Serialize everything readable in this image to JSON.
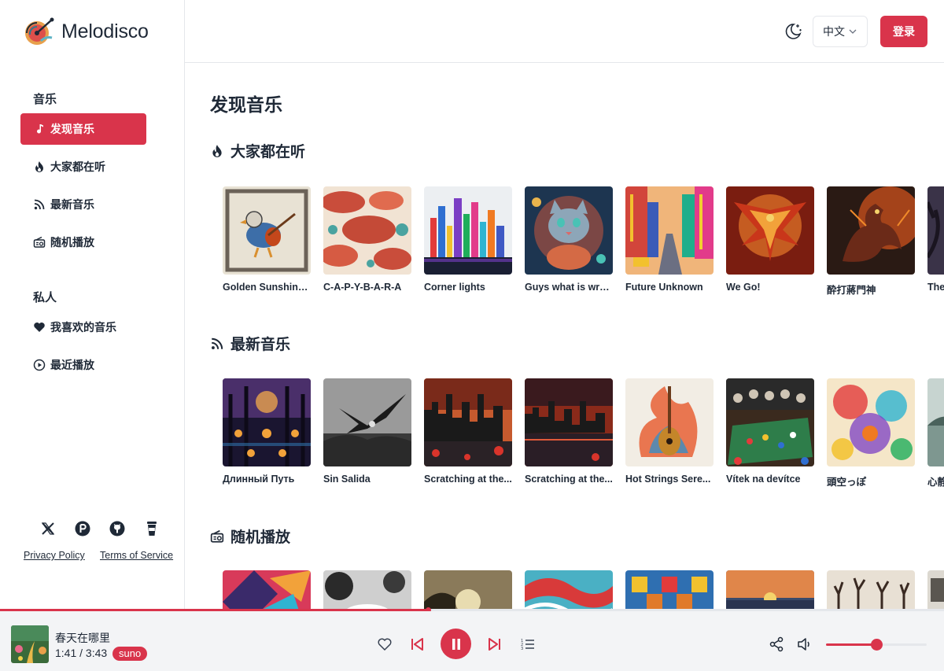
{
  "brand": {
    "name": "Melodisco"
  },
  "header": {
    "language": "中文",
    "login_label": "登录"
  },
  "sidebar": {
    "music_label": "音乐",
    "private_label": "私人",
    "music_items": [
      {
        "label": "发现音乐",
        "icon": "music-note-icon"
      },
      {
        "label": "大家都在听",
        "icon": "flame-icon"
      },
      {
        "label": "最新音乐",
        "icon": "rss-icon"
      },
      {
        "label": "随机播放",
        "icon": "radio-icon"
      }
    ],
    "private_items": [
      {
        "label": "我喜欢的音乐",
        "icon": "heart-icon"
      },
      {
        "label": "最近播放",
        "icon": "play-circle-icon"
      }
    ],
    "social": [
      "x-icon",
      "product-hunt-icon",
      "github-icon",
      "coffee-cup-icon"
    ],
    "privacy_label": "Privacy Policy",
    "terms_label": "Terms of Service"
  },
  "main": {
    "title": "发现音乐",
    "sections": [
      {
        "title": "大家都在听",
        "icon": "flame-icon",
        "songs": [
          "Golden Sunshine...",
          "C-A-P-Y-B-A-R-A",
          "Corner lights",
          "Guys what is wro...",
          "Future Unknown",
          "We Go!",
          "酔打蔣門神",
          "The"
        ]
      },
      {
        "title": "最新音乐",
        "icon": "rss-icon",
        "songs": [
          "Длинный Путь",
          "Sin Salida",
          "Scratching at the...",
          "Scratching at the...",
          "Hot Strings Sere...",
          "Vítek na devítce",
          "頭空っぽ",
          "心静"
        ]
      },
      {
        "title": "随机播放",
        "icon": "radio-icon",
        "songs": [
          "",
          "",
          "",
          "",
          "",
          "",
          "",
          ""
        ]
      }
    ]
  },
  "player": {
    "title": "春天在哪里",
    "time": "1:41 / 3:43",
    "badge": "suno",
    "progress": 0.453,
    "volume": 0.5
  },
  "colors": {
    "accent": "#d9344b",
    "player_bg": "#f3f4f6"
  }
}
